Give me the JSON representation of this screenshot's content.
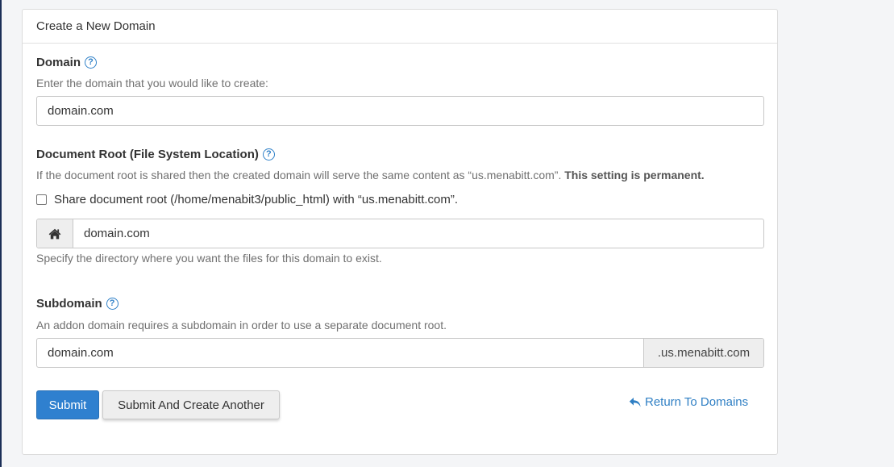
{
  "panel": {
    "title": "Create a New Domain"
  },
  "domain": {
    "label": "Domain",
    "help_icon": "question-circle-icon",
    "hint": "Enter the domain that you would like to create:",
    "value": "domain.com"
  },
  "document_root": {
    "label": "Document Root (File System Location)",
    "help_icon": "question-circle-icon",
    "hint": "If the document root is shared then the created domain will serve the same content as “us.menabitt.com”.",
    "hint_bold": "This setting is permanent.",
    "share_checkbox_label": "Share document root (/home/menabit3/public_html) with “us.menabitt.com”.",
    "share_checked": false,
    "home_icon": "home-icon",
    "value": "domain.com",
    "footer_hint": "Specify the directory where you want the files for this domain to exist."
  },
  "subdomain": {
    "label": "Subdomain",
    "help_icon": "question-circle-icon",
    "hint": "An addon domain requires a subdomain in order to use a separate document root.",
    "value": "domain.com",
    "suffix": ".us.menabitt.com"
  },
  "actions": {
    "submit_label": "Submit",
    "submit_another_label": "Submit And Create Another",
    "return_icon": "reply-arrow-icon",
    "return_label": "Return To Domains"
  },
  "colors": {
    "primary": "#2f80cf",
    "link": "#2f7fc4"
  }
}
